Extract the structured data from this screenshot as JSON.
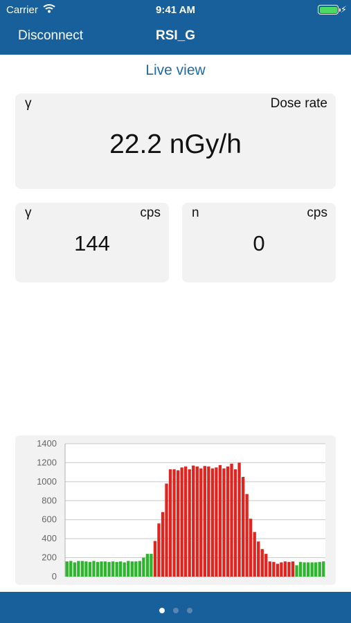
{
  "status_bar": {
    "carrier": "Carrier",
    "time": "9:41 AM",
    "battery_color": "#4cd964"
  },
  "nav": {
    "left_button": "Disconnect",
    "title": "RSI_G"
  },
  "view_title": "Live view",
  "dose_card": {
    "left_label": "γ",
    "right_label": "Dose rate",
    "value": "22.2 nGy/h"
  },
  "gamma_card": {
    "left_label": "γ",
    "right_label": "cps",
    "value": "144"
  },
  "neutron_card": {
    "left_label": "n",
    "right_label": "cps",
    "value": "0"
  },
  "page_indicator": {
    "count": 3,
    "active": 0
  },
  "colors": {
    "bar": "#17609b",
    "accent": "#1f6aa8",
    "green": "#2db52d",
    "red": "#e0241f"
  },
  "chart_data": {
    "type": "bar",
    "title": "",
    "xlabel": "",
    "ylabel": "",
    "ylim": [
      0,
      1400
    ],
    "yticks": [
      0,
      200,
      400,
      600,
      800,
      1000,
      1200,
      1400
    ],
    "grid": true,
    "values": [
      160,
      165,
      150,
      165,
      165,
      160,
      155,
      165,
      155,
      160,
      160,
      155,
      160,
      155,
      160,
      150,
      165,
      160,
      160,
      165,
      200,
      240,
      240,
      375,
      560,
      680,
      980,
      1130,
      1130,
      1120,
      1150,
      1160,
      1130,
      1170,
      1160,
      1140,
      1165,
      1160,
      1140,
      1150,
      1175,
      1140,
      1160,
      1190,
      1130,
      1200,
      1050,
      870,
      610,
      470,
      370,
      290,
      240,
      160,
      155,
      135,
      150,
      160,
      155,
      160,
      120,
      155,
      150,
      150,
      150,
      150,
      155,
      160
    ],
    "colors": [
      "g",
      "g",
      "g",
      "g",
      "g",
      "g",
      "g",
      "g",
      "g",
      "g",
      "g",
      "g",
      "g",
      "g",
      "g",
      "g",
      "g",
      "g",
      "g",
      "g",
      "g",
      "g",
      "g",
      "r",
      "r",
      "r",
      "r",
      "r",
      "r",
      "r",
      "r",
      "r",
      "r",
      "r",
      "r",
      "r",
      "r",
      "r",
      "r",
      "r",
      "r",
      "r",
      "r",
      "r",
      "r",
      "r",
      "r",
      "r",
      "r",
      "r",
      "r",
      "r",
      "r",
      "r",
      "r",
      "r",
      "r",
      "r",
      "r",
      "r",
      "g",
      "g",
      "g",
      "g",
      "g",
      "g",
      "g",
      "g"
    ]
  }
}
